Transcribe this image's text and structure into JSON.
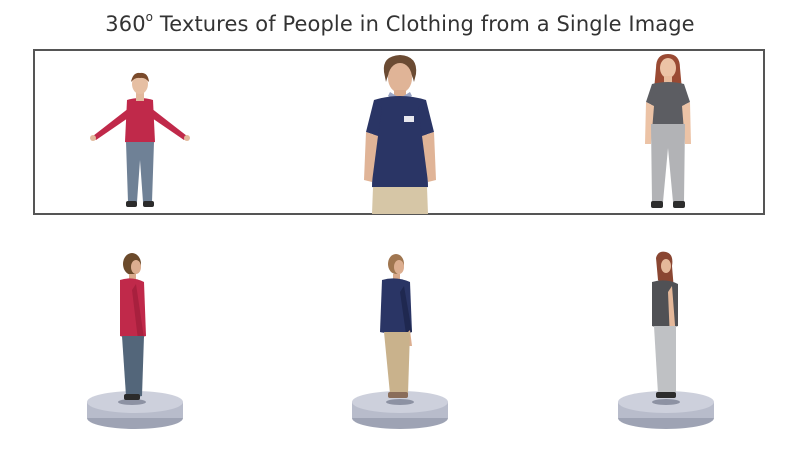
{
  "header": {
    "title_prefix": "360",
    "title_superscript": "o",
    "title_suffix": " Textures of People in Clothing from a Single Image"
  },
  "input_row": {
    "figures": [
      {
        "name": "avatar-a-pose-red-top",
        "top_color": "#c0294a",
        "pants_color": "#6f8196",
        "hair_color": "#7a4a2b"
      },
      {
        "name": "man-navy-polo",
        "top_color": "#2a3565",
        "pants_color": "#d6c6a6",
        "hair_color": "#6b4b33"
      },
      {
        "name": "woman-grey-tee",
        "top_color": "#5c5d62",
        "pants_color": "#b2b3b6",
        "hair_color": "#9a4a33"
      }
    ]
  },
  "output_row": {
    "figures": [
      {
        "name": "textured-avatar-red-top",
        "top_color": "#c0294a",
        "pants_color": "#53667a",
        "hair_color": "#6b4a2b"
      },
      {
        "name": "textured-avatar-navy-polo",
        "top_color": "#2a3565",
        "pants_color": "#c9b28c",
        "hair_color": "#a07650"
      },
      {
        "name": "textured-avatar-grey-tee",
        "top_color": "#505155",
        "pants_color": "#bfc1c4",
        "hair_color": "#8a4632"
      }
    ],
    "platform_color": "#b8bccb"
  }
}
